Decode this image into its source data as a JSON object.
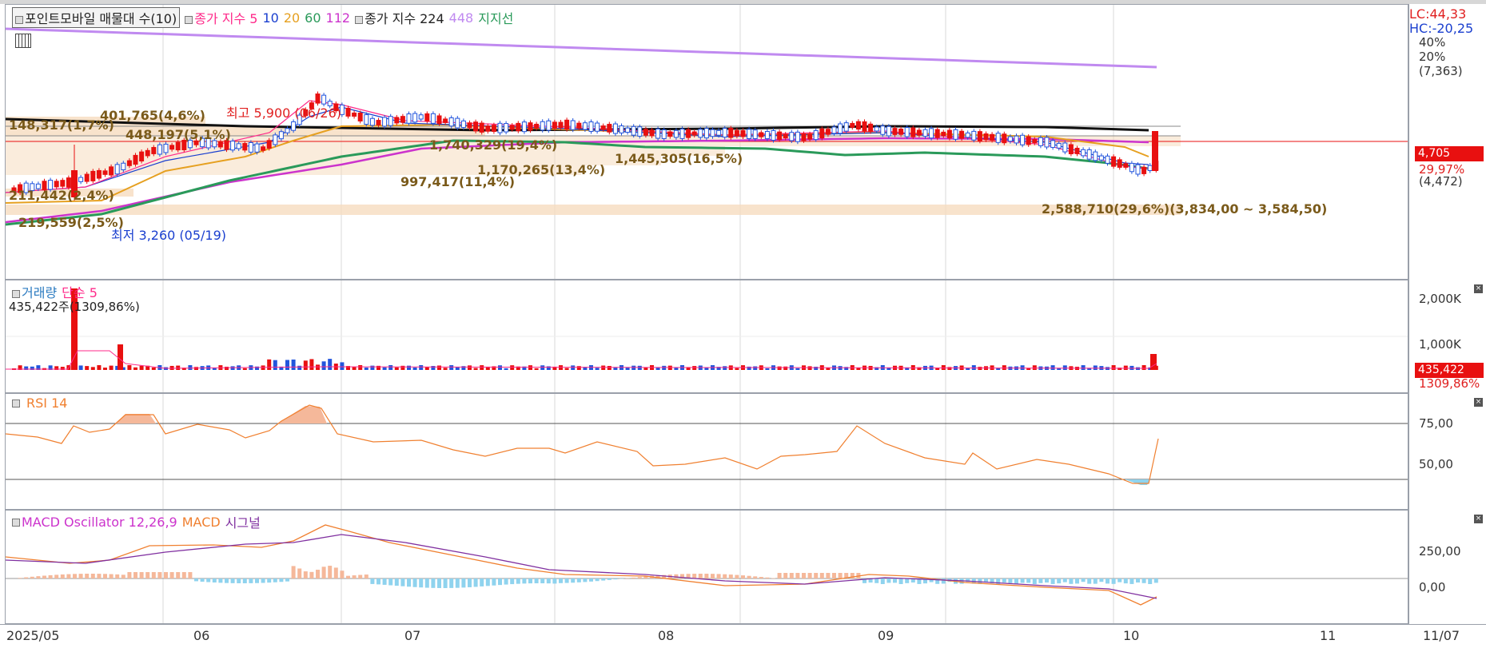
{
  "price_legend": {
    "title": "포인트모바일 매물대 수(10)",
    "ma_label": "종가 지수 5",
    "ma10": "10",
    "ma20": "20",
    "ma60": "60",
    "ma112": "112",
    "ma224_label": "종가 지수 224",
    "ma448": "448",
    "support": "지지선"
  },
  "price_scale": {
    "lc": "LC:44,33",
    "hc": "HC:-20,25",
    "p40": "40%",
    "p20": "20%",
    "top_val": "(7,363)",
    "current": "4,705",
    "pct": "29,97%",
    "low_val": "(4,472)"
  },
  "price_annotations": {
    "a1": "148,317(1,7%)",
    "a2": "401,765(4,6%)",
    "a3": "448,197(5,1%)",
    "a4": "1,740,329(19,4%)",
    "a5": "1,445,305(16,5%)",
    "a6": "1,170,265(13,4%)",
    "a7": "997,417(11,4%)",
    "a8": "211,442(2,4%)",
    "a9": "219,559(2,5%)",
    "a10": "2,588,710(29,6%)(3,834,00 ~ 3,584,50)",
    "high": "최고 5,900 (06/26)",
    "low": "최저 3,260 (05/19)"
  },
  "volume": {
    "label": "거래량",
    "ma_label": "단순 5",
    "value_text": "435,422주(1309,86%)",
    "scale_2000": "2,000K",
    "scale_1000": "1,000K",
    "current": "435,422",
    "pct": "1309,86%"
  },
  "rsi": {
    "label": "RSI 14",
    "s75": "75,00",
    "s50": "50,00"
  },
  "macd": {
    "label": "MACD Oscillator 12,26,9",
    "macd": "MACD",
    "signal": "시그널",
    "s250": "250,00",
    "s0": "0,00"
  },
  "x_axis": [
    "2025/05",
    "06",
    "07",
    "08",
    "09",
    "10",
    "11",
    "11/07"
  ],
  "colors": {
    "up": "#e81010",
    "down": "#2255dd",
    "ma5": "#ff2a8a",
    "ma10": "#1a3fcf",
    "ma20": "#e6a020",
    "ma60": "#2a9a5a",
    "ma112": "#cc33cc",
    "ma224": "#111111",
    "ma448": "#c08af0",
    "zone": "#f6dcbf",
    "rsi": "#f08030",
    "macd": "#f08030",
    "signal": "#8030a0",
    "osc_pos": "#f5b89a",
    "osc_neg": "#8fd3ee"
  }
}
